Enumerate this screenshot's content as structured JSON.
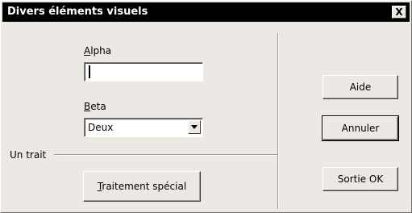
{
  "window": {
    "title": "Divers éléments visuels",
    "close_label": "X"
  },
  "alpha": {
    "label_accel": "A",
    "label_rest": "lpha",
    "value": ""
  },
  "beta": {
    "label_accel": "B",
    "label_rest": "eta",
    "selected": "Deux"
  },
  "line_label": "Un trait",
  "special_button": {
    "label_accel": "T",
    "label_rest": "raitement spécial"
  },
  "buttons": {
    "help": "Aide",
    "cancel": "Annuler",
    "ok": "Sortie OK"
  }
}
